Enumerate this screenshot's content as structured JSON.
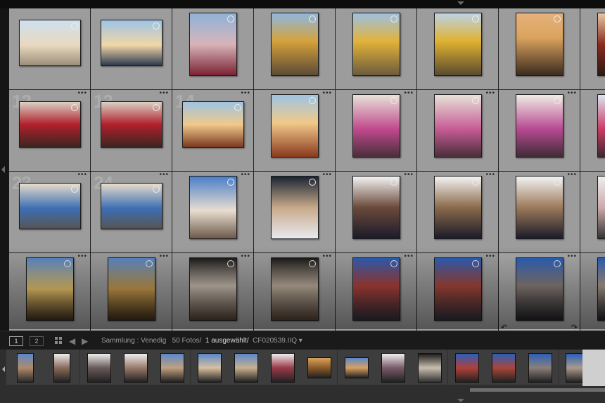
{
  "toolbar": {
    "page1": "1",
    "page2": "2",
    "collection_label": "Sammlung : Venedig",
    "photo_count": "50 Fotos/",
    "selected": "1 ausgewählt/",
    "filename": "CF020539.IIQ"
  },
  "grid": {
    "rows": [
      {
        "numbers": [
          "",
          "",
          "",
          "",
          "",
          "",
          "",
          ""
        ]
      },
      {
        "numbers": [
          "12",
          "13",
          "14",
          "",
          "",
          "",
          "",
          ""
        ]
      },
      {
        "numbers": [
          "23",
          "24",
          "",
          "",
          "",
          "",
          "",
          ""
        ]
      },
      {
        "numbers": [
          "",
          "",
          "",
          "",
          "",
          "",
          "",
          ""
        ]
      }
    ]
  },
  "icons": {
    "grid_view": "grid-view-icon",
    "prev": "arrow-left-icon",
    "next": "arrow-right-icon",
    "rotate_left": "rotate-left-icon",
    "rotate_right": "rotate-right-icon"
  },
  "glyphs": {
    "arrow_left": "◀",
    "arrow_right": "▶",
    "rotate_left": "↶",
    "rotate_right": "↷",
    "more": "•••",
    "dropdown": "▾"
  }
}
